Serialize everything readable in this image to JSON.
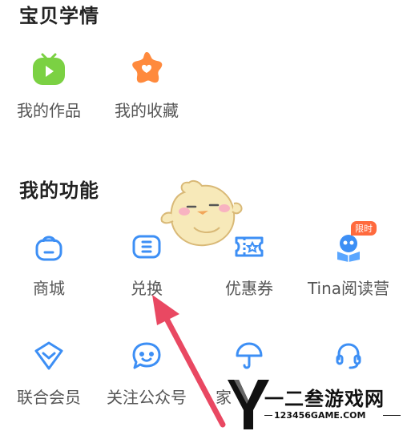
{
  "sections": {
    "baby_info_title": "宝贝学情",
    "my_features_title": "我的功能"
  },
  "baby_info": {
    "works_label": "我的作品",
    "favorites_label": "我的收藏"
  },
  "features": {
    "mall_label": "商城",
    "redeem_label": "兑换",
    "coupon_label": "优惠券",
    "tina_label": "Tina阅读营",
    "tina_badge": "限时",
    "membership_label": "联合会员",
    "follow_label": "关注公众号",
    "partial_label": "家"
  },
  "watermark": {
    "title": "一二叁游戏网",
    "url": "123456GAME.COM"
  },
  "colors": {
    "accent_blue": "#3d8ff5",
    "works_green": "#7bd143",
    "favorites_orange": "#ff8a3d",
    "arrow_red": "#e94862",
    "badge_orange": "#ff6a3d"
  }
}
